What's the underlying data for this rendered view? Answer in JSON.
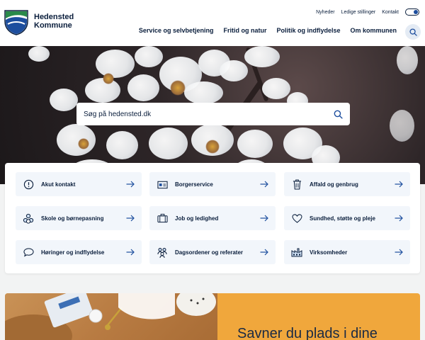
{
  "header": {
    "logo_line1": "Hedensted",
    "logo_line2": "Kommune",
    "utility_links": [
      "Nyheder",
      "Ledige stillinger",
      "Kontakt"
    ],
    "main_nav": [
      "Service og selvbetjening",
      "Fritid og natur",
      "Politik og indflydelse",
      "Om kommunen"
    ]
  },
  "hero": {
    "search_placeholder": "Søg på hedensted.dk"
  },
  "tiles": [
    {
      "label": "Akut kontakt",
      "icon": "alert-circle-icon"
    },
    {
      "label": "Borgerservice",
      "icon": "id-card-icon"
    },
    {
      "label": "Affald og genbrug",
      "icon": "trash-icon"
    },
    {
      "label": "Skole og børnepasning",
      "icon": "blocks-icon"
    },
    {
      "label": "Job og ledighed",
      "icon": "briefcase-icon"
    },
    {
      "label": "Sundhed, støtte og pleje",
      "icon": "heart-icon"
    },
    {
      "label": "Høringer og indflydelse",
      "icon": "speech-bubble-icon"
    },
    {
      "label": "Dagsordener og referater",
      "icon": "people-icon"
    },
    {
      "label": "Virksomheder",
      "icon": "factory-icon"
    }
  ],
  "promo": {
    "title": "Savner du plads i dine"
  },
  "colors": {
    "navy": "#0a1e3c",
    "accent_blue": "#1d4e9e",
    "tile_bg": "#f2f6fb",
    "promo_orange": "#f0a73c",
    "logo_green": "#2a8a4a"
  }
}
